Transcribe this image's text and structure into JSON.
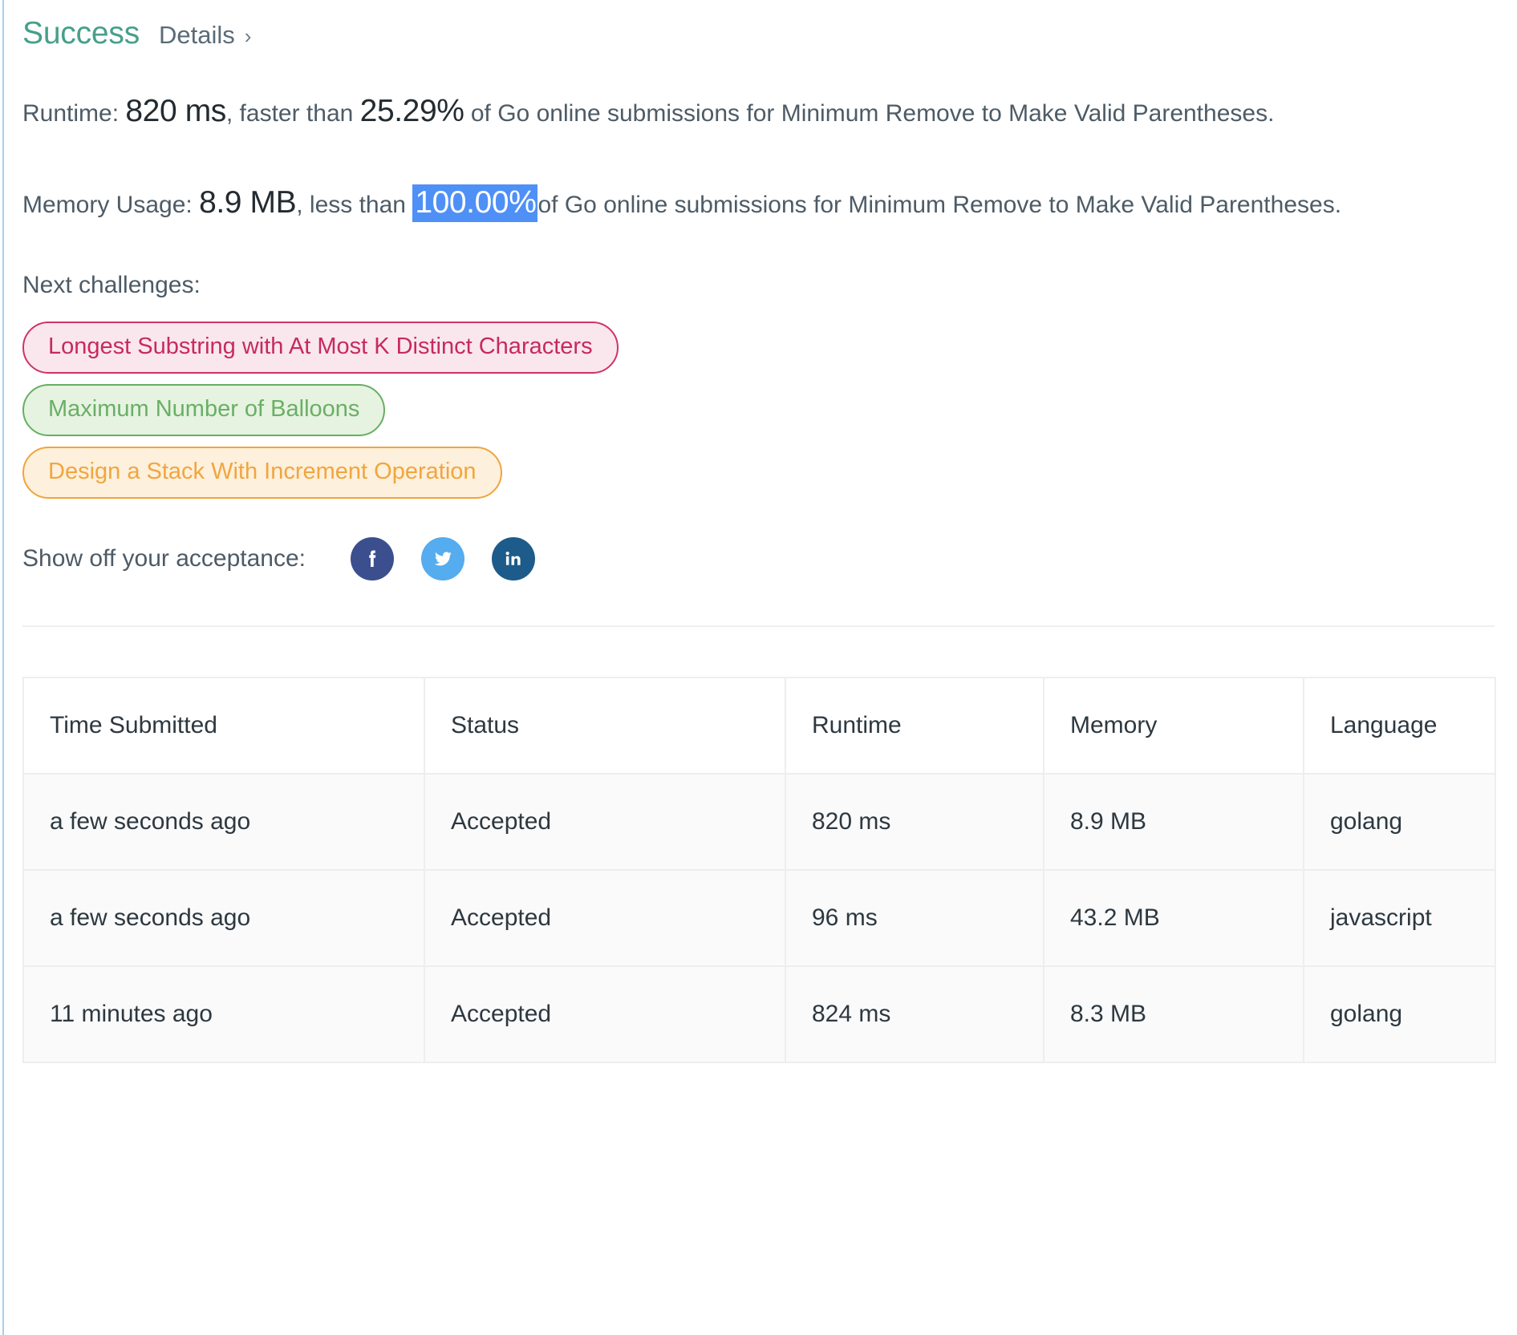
{
  "header": {
    "status": "Success",
    "details_label": "Details",
    "chevron": "›"
  },
  "runtime_stat": {
    "label_prefix": "Runtime: ",
    "value": "820 ms",
    "mid_text": ", faster than ",
    "percent": "25.29%",
    "suffix": " of Go online submissions for Minimum Remove to Make Valid Parentheses."
  },
  "memory_stat": {
    "label_prefix": "Memory Usage: ",
    "value": "8.9 MB",
    "mid_text": ", less than ",
    "percent": "100.00%",
    "percent_selected": true,
    "suffix": "of Go online submissions for Minimum Remove to Make Valid Parentheses."
  },
  "next_challenges": {
    "label": "Next challenges:",
    "tags": [
      {
        "text": "Longest Substring with At Most K Distinct Characters",
        "color": "pink"
      },
      {
        "text": "Maximum Number of Balloons",
        "color": "green"
      },
      {
        "text": "Design a Stack With Increment Operation",
        "color": "orange"
      }
    ]
  },
  "share": {
    "label": "Show off your acceptance:",
    "networks": [
      {
        "name": "facebook",
        "icon": "facebook-icon",
        "color": "#3b4f8f"
      },
      {
        "name": "twitter",
        "icon": "twitter-icon",
        "color": "#55acee"
      },
      {
        "name": "linkedin",
        "icon": "linkedin-icon",
        "color": "#1d5b8a"
      }
    ]
  },
  "submissions_table": {
    "columns": [
      "Time Submitted",
      "Status",
      "Runtime",
      "Memory",
      "Language"
    ],
    "rows": [
      {
        "time": "a few seconds ago",
        "status": "Accepted",
        "runtime": "820 ms",
        "memory": "8.9 MB",
        "language": "golang"
      },
      {
        "time": "a few seconds ago",
        "status": "Accepted",
        "runtime": "96 ms",
        "memory": "43.2 MB",
        "language": "javascript"
      },
      {
        "time": "11 minutes ago",
        "status": "Accepted",
        "runtime": "824 ms",
        "memory": "8.3 MB",
        "language": "golang"
      }
    ]
  },
  "colors": {
    "success_green": "#46a08a",
    "accepted_green": "#31907c",
    "selection_blue": "#4f90f7",
    "text_slate": "#4d5b66",
    "tag_pink_border": "#cf3369",
    "tag_green_border": "#66af62",
    "tag_orange_border": "#f0a43c"
  }
}
